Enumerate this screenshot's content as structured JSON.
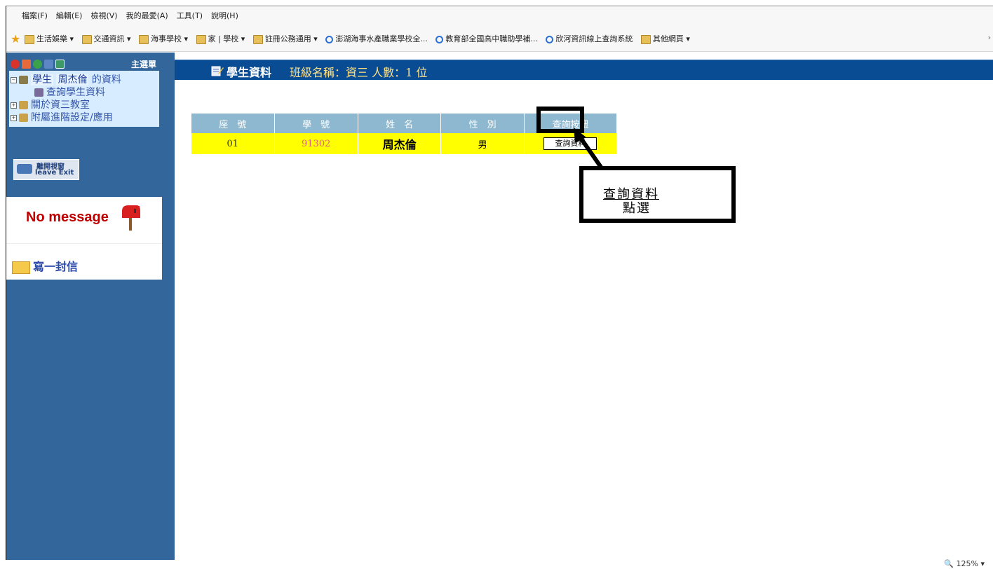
{
  "menu": [
    "檔案(F)",
    "編輯(E)",
    "檢視(V)",
    "我的最愛(A)",
    "工具(T)",
    "說明(H)"
  ],
  "favorites": [
    {
      "icon": "folder-icon",
      "label": "生活娛樂 ▾"
    },
    {
      "icon": "folder-icon",
      "label": "交通資訊 ▾"
    },
    {
      "icon": "folder-icon",
      "label": "海事學校 ▾"
    },
    {
      "icon": "folder-icon",
      "label": "家 | 學校 ▾"
    },
    {
      "icon": "folder-icon",
      "label": "註冊公務通用 ▾"
    },
    {
      "icon": "ie-icon",
      "label": "澎湖海事水產職業學校全..."
    },
    {
      "icon": "ie-icon",
      "label": "教育部全國高中職助學補..."
    },
    {
      "icon": "ie-icon",
      "label": "欣河資訊線上查詢系統"
    },
    {
      "icon": "folder-icon",
      "label": "其他網頁 ▾"
    }
  ],
  "favorites_more": "›",
  "sidebar": {
    "title": "主選單",
    "tree": {
      "student_prefix": "學生",
      "student_name": "周杰倫",
      "student_suffix": "的資料",
      "query_item": "查詢學生資料",
      "about": "關於資三教室",
      "settings": "附屬進階設定/應用"
    },
    "leave_line1": "離開視窗",
    "leave_line2": "leave Exit",
    "no_message": "No message",
    "write_letter": "寫一封信"
  },
  "content": {
    "header_title": "學生資料",
    "header_class": "班級名稱：資三 人數：1 位",
    "table": {
      "headers": [
        "座　號",
        "學　號",
        "姓　名",
        "性　別",
        "查詢按鈕"
      ],
      "row": {
        "seat": "01",
        "student_id": "91302",
        "name": "周杰倫",
        "gender": "男",
        "button": "查詢資料"
      }
    },
    "callout": {
      "prefix": "點選",
      "underlined": "查詢資料"
    }
  },
  "status": {
    "zoom": "🔍 125%  ▾"
  },
  "colors": {
    "sidebar_bg": "#33669a",
    "header_bg": "#0a4c93",
    "table_header_bg": "#8eb8cf",
    "table_row_bg": "#ffff00"
  }
}
